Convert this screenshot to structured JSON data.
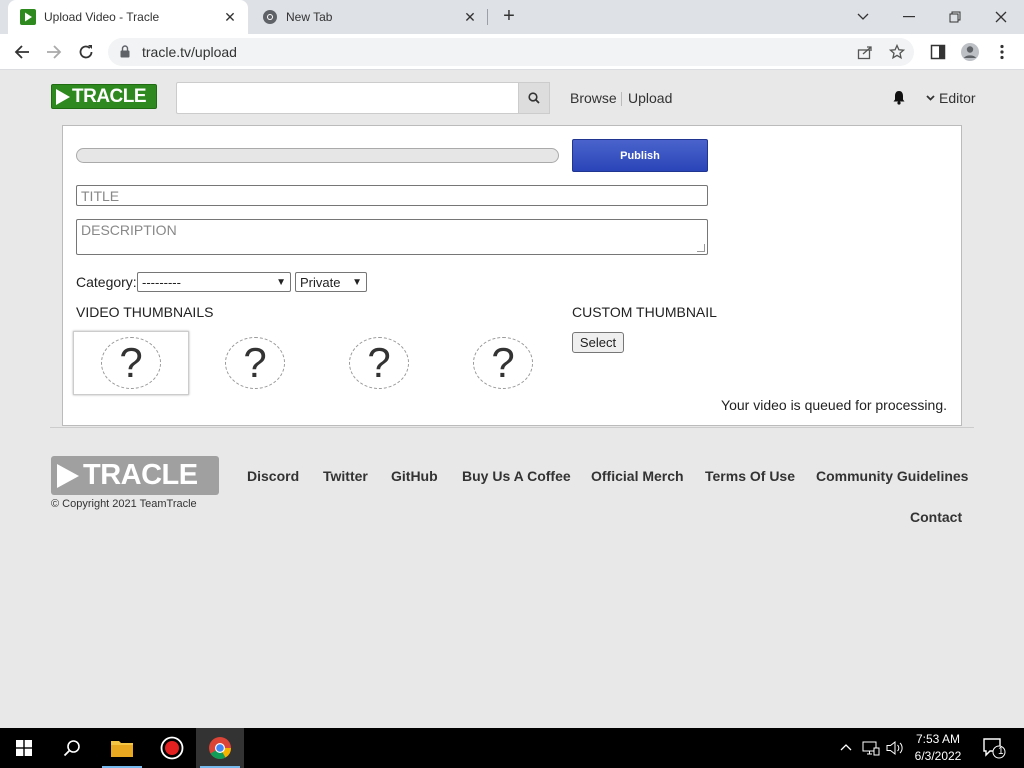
{
  "browser": {
    "tabs": [
      {
        "title": "Upload Video - Tracle",
        "active": true,
        "favicon": "tracle-play-icon"
      },
      {
        "title": "New Tab",
        "active": false,
        "favicon": "chrome-icon"
      }
    ],
    "url": "tracle.tv/upload"
  },
  "site": {
    "logo_text": "TRACLE",
    "search": {
      "placeholder": "",
      "value": ""
    },
    "nav": {
      "browse": "Browse",
      "upload": "Upload"
    },
    "user": {
      "name": "Editor"
    }
  },
  "upload": {
    "progress": 0,
    "publish_label": "Publish",
    "title_placeholder": "TITLE",
    "description_placeholder": "DESCRIPTION",
    "category_label": "Category:",
    "category_selected": "---------",
    "privacy_selected": "Private",
    "video_thumbnails_heading": "VIDEO THUMBNAILS",
    "thumbnail_placeholder": "?",
    "custom_thumbnail_heading": "CUSTOM THUMBNAIL",
    "select_label": "Select",
    "status": "Your video is queued for processing."
  },
  "footer": {
    "logo_text": "TRACLE",
    "copyright": "© Copyright 2021 TeamTracle",
    "links": [
      "Discord",
      "Twitter",
      "GitHub",
      "Buy Us A Coffee",
      "Official Merch",
      "Terms Of Use",
      "Community Guidelines",
      "Contact"
    ]
  },
  "taskbar": {
    "time": "7:53 AM",
    "date": "6/3/2022",
    "notifications": "1"
  },
  "colors": {
    "brand_green": "#2e8a1e",
    "publish_blue": "#2a45b8",
    "page_bg": "#e8e8e8"
  }
}
